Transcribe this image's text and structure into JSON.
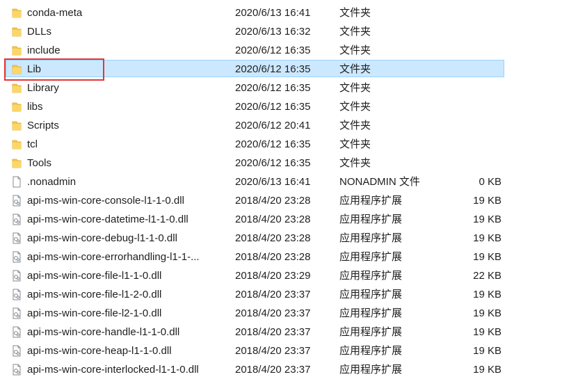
{
  "accent_colors": {
    "selection_fill": "#cce8ff",
    "selection_border": "#99d1ff",
    "highlight_box": "#e0373a",
    "folder_icon": "#f6c84a"
  },
  "items": [
    {
      "name": "conda-meta",
      "date": "2020/6/13 16:41",
      "type": "文件夹",
      "size": "",
      "icon": "folder-icon"
    },
    {
      "name": "DLLs",
      "date": "2020/6/13 16:32",
      "type": "文件夹",
      "size": "",
      "icon": "folder-icon"
    },
    {
      "name": "include",
      "date": "2020/6/12 16:35",
      "type": "文件夹",
      "size": "",
      "icon": "folder-icon"
    },
    {
      "name": "Lib",
      "date": "2020/6/12 16:35",
      "type": "文件夹",
      "size": "",
      "icon": "folder-icon"
    },
    {
      "name": "Library",
      "date": "2020/6/12 16:35",
      "type": "文件夹",
      "size": "",
      "icon": "folder-icon"
    },
    {
      "name": "libs",
      "date": "2020/6/12 16:35",
      "type": "文件夹",
      "size": "",
      "icon": "folder-icon"
    },
    {
      "name": "Scripts",
      "date": "2020/6/12 20:41",
      "type": "文件夹",
      "size": "",
      "icon": "folder-icon"
    },
    {
      "name": "tcl",
      "date": "2020/6/12 16:35",
      "type": "文件夹",
      "size": "",
      "icon": "folder-icon"
    },
    {
      "name": "Tools",
      "date": "2020/6/12 16:35",
      "type": "文件夹",
      "size": "",
      "icon": "folder-icon"
    },
    {
      "name": ".nonadmin",
      "date": "2020/6/13 16:41",
      "type": "NONADMIN 文件",
      "size": "0 KB",
      "icon": "blank-file-icon"
    },
    {
      "name": "api-ms-win-core-console-l1-1-0.dll",
      "date": "2018/4/20 23:28",
      "type": "应用程序扩展",
      "size": "19 KB",
      "icon": "dll-file-icon"
    },
    {
      "name": "api-ms-win-core-datetime-l1-1-0.dll",
      "date": "2018/4/20 23:28",
      "type": "应用程序扩展",
      "size": "19 KB",
      "icon": "dll-file-icon"
    },
    {
      "name": "api-ms-win-core-debug-l1-1-0.dll",
      "date": "2018/4/20 23:28",
      "type": "应用程序扩展",
      "size": "19 KB",
      "icon": "dll-file-icon"
    },
    {
      "name": "api-ms-win-core-errorhandling-l1-1-...",
      "date": "2018/4/20 23:28",
      "type": "应用程序扩展",
      "size": "19 KB",
      "icon": "dll-file-icon"
    },
    {
      "name": "api-ms-win-core-file-l1-1-0.dll",
      "date": "2018/4/20 23:29",
      "type": "应用程序扩展",
      "size": "22 KB",
      "icon": "dll-file-icon"
    },
    {
      "name": "api-ms-win-core-file-l1-2-0.dll",
      "date": "2018/4/20 23:37",
      "type": "应用程序扩展",
      "size": "19 KB",
      "icon": "dll-file-icon"
    },
    {
      "name": "api-ms-win-core-file-l2-1-0.dll",
      "date": "2018/4/20 23:37",
      "type": "应用程序扩展",
      "size": "19 KB",
      "icon": "dll-file-icon"
    },
    {
      "name": "api-ms-win-core-handle-l1-1-0.dll",
      "date": "2018/4/20 23:37",
      "type": "应用程序扩展",
      "size": "19 KB",
      "icon": "dll-file-icon"
    },
    {
      "name": "api-ms-win-core-heap-l1-1-0.dll",
      "date": "2018/4/20 23:37",
      "type": "应用程序扩展",
      "size": "19 KB",
      "icon": "dll-file-icon"
    },
    {
      "name": "api-ms-win-core-interlocked-l1-1-0.dll",
      "date": "2018/4/20 23:37",
      "type": "应用程序扩展",
      "size": "19 KB",
      "icon": "dll-file-icon"
    }
  ]
}
